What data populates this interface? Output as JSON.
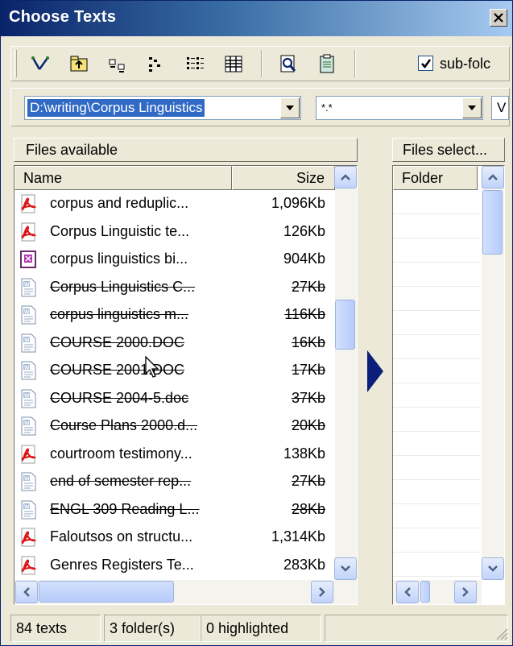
{
  "window": {
    "title": "Choose Texts"
  },
  "toolbar": {
    "subfolders_label": "sub-folc",
    "subfolders_checked": true
  },
  "path": {
    "folder": "D:\\writing\\Corpus Linguistics",
    "filter": "*.*",
    "third": "V"
  },
  "files_available": {
    "header": "Files available",
    "columns": {
      "name": "Name",
      "size": "Size"
    },
    "rows": [
      {
        "icon": "pdf-icon",
        "name": "corpus and reduplic...",
        "size": "1,096Kb",
        "struck": false
      },
      {
        "icon": "pdf-icon",
        "name": "Corpus Linguistic te...",
        "size": "126Kb",
        "struck": false
      },
      {
        "icon": "ppt-icon",
        "name": "corpus linguistics bi...",
        "size": "904Kb",
        "struck": false
      },
      {
        "icon": "word-icon",
        "name": "Corpus Linguistics C...",
        "size": "27Kb",
        "struck": true
      },
      {
        "icon": "word-icon",
        "name": "corpus linguistics m...",
        "size": "116Kb",
        "struck": true
      },
      {
        "icon": "word-icon",
        "name": "COURSE 2000.DOC",
        "size": "16Kb",
        "struck": true
      },
      {
        "icon": "word-icon",
        "name": "COURSE 2001.DOC",
        "size": "17Kb",
        "struck": true
      },
      {
        "icon": "word-icon",
        "name": "COURSE 2004-5.doc",
        "size": "37Kb",
        "struck": true
      },
      {
        "icon": "word-icon",
        "name": "Course Plans 2000.d...",
        "size": "20Kb",
        "struck": true
      },
      {
        "icon": "pdf-icon",
        "name": "courtroom testimony...",
        "size": "138Kb",
        "struck": false
      },
      {
        "icon": "word-icon",
        "name": "end of semester rep...",
        "size": "27Kb",
        "struck": true
      },
      {
        "icon": "word-icon",
        "name": "ENGL 309 Reading L...",
        "size": "28Kb",
        "struck": true
      },
      {
        "icon": "pdf-icon",
        "name": "Faloutsos on structu...",
        "size": "1,314Kb",
        "struck": false
      },
      {
        "icon": "pdf-icon",
        "name": "Genres Registers Te...",
        "size": "283Kb",
        "struck": false
      }
    ]
  },
  "files_selected": {
    "header": "Files select...",
    "columns": {
      "folder": "Folder"
    }
  },
  "status": {
    "texts": "84 texts",
    "folders": "3 folder(s)",
    "highlighted": "0 highlighted"
  }
}
